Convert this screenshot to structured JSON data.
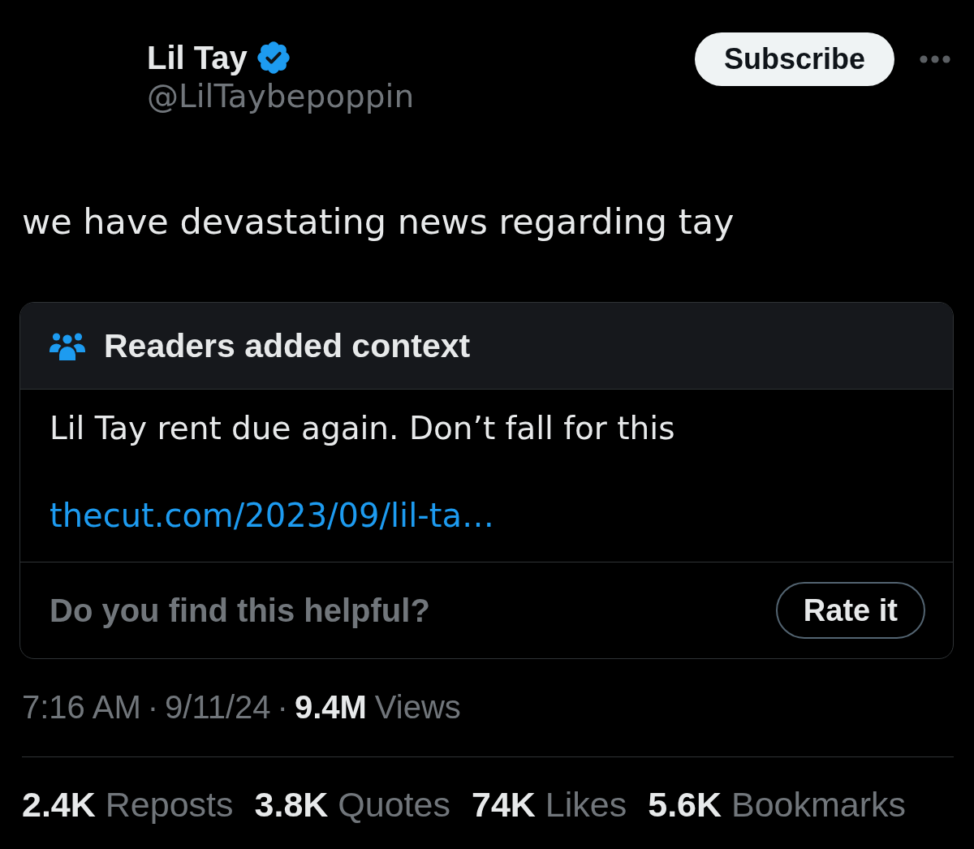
{
  "author": {
    "name": "Lil Tay",
    "verified": true,
    "handle": "@LilTaybepoppin"
  },
  "actions": {
    "subscribe": "Subscribe"
  },
  "tweet": {
    "text": "we have devastating news regarding tay"
  },
  "community_note": {
    "title": "Readers added context",
    "text": "Lil Tay rent due again. Don’t fall for this",
    "link": "thecut.com/2023/09/lil-ta…",
    "question": "Do you find this helpful?",
    "rate_button": "Rate it"
  },
  "meta": {
    "time": "7:16 AM",
    "separator_1": "·",
    "date": "9/11/24",
    "separator_2": "·",
    "views": "9.4M",
    "views_label": "Views"
  },
  "stats": [
    {
      "count": "2.4K",
      "label": "Reposts"
    },
    {
      "count": "3.8K",
      "label": "Quotes"
    },
    {
      "count": "74K",
      "label": "Likes"
    },
    {
      "count": "5.6K",
      "label": "Bookmarks"
    }
  ]
}
